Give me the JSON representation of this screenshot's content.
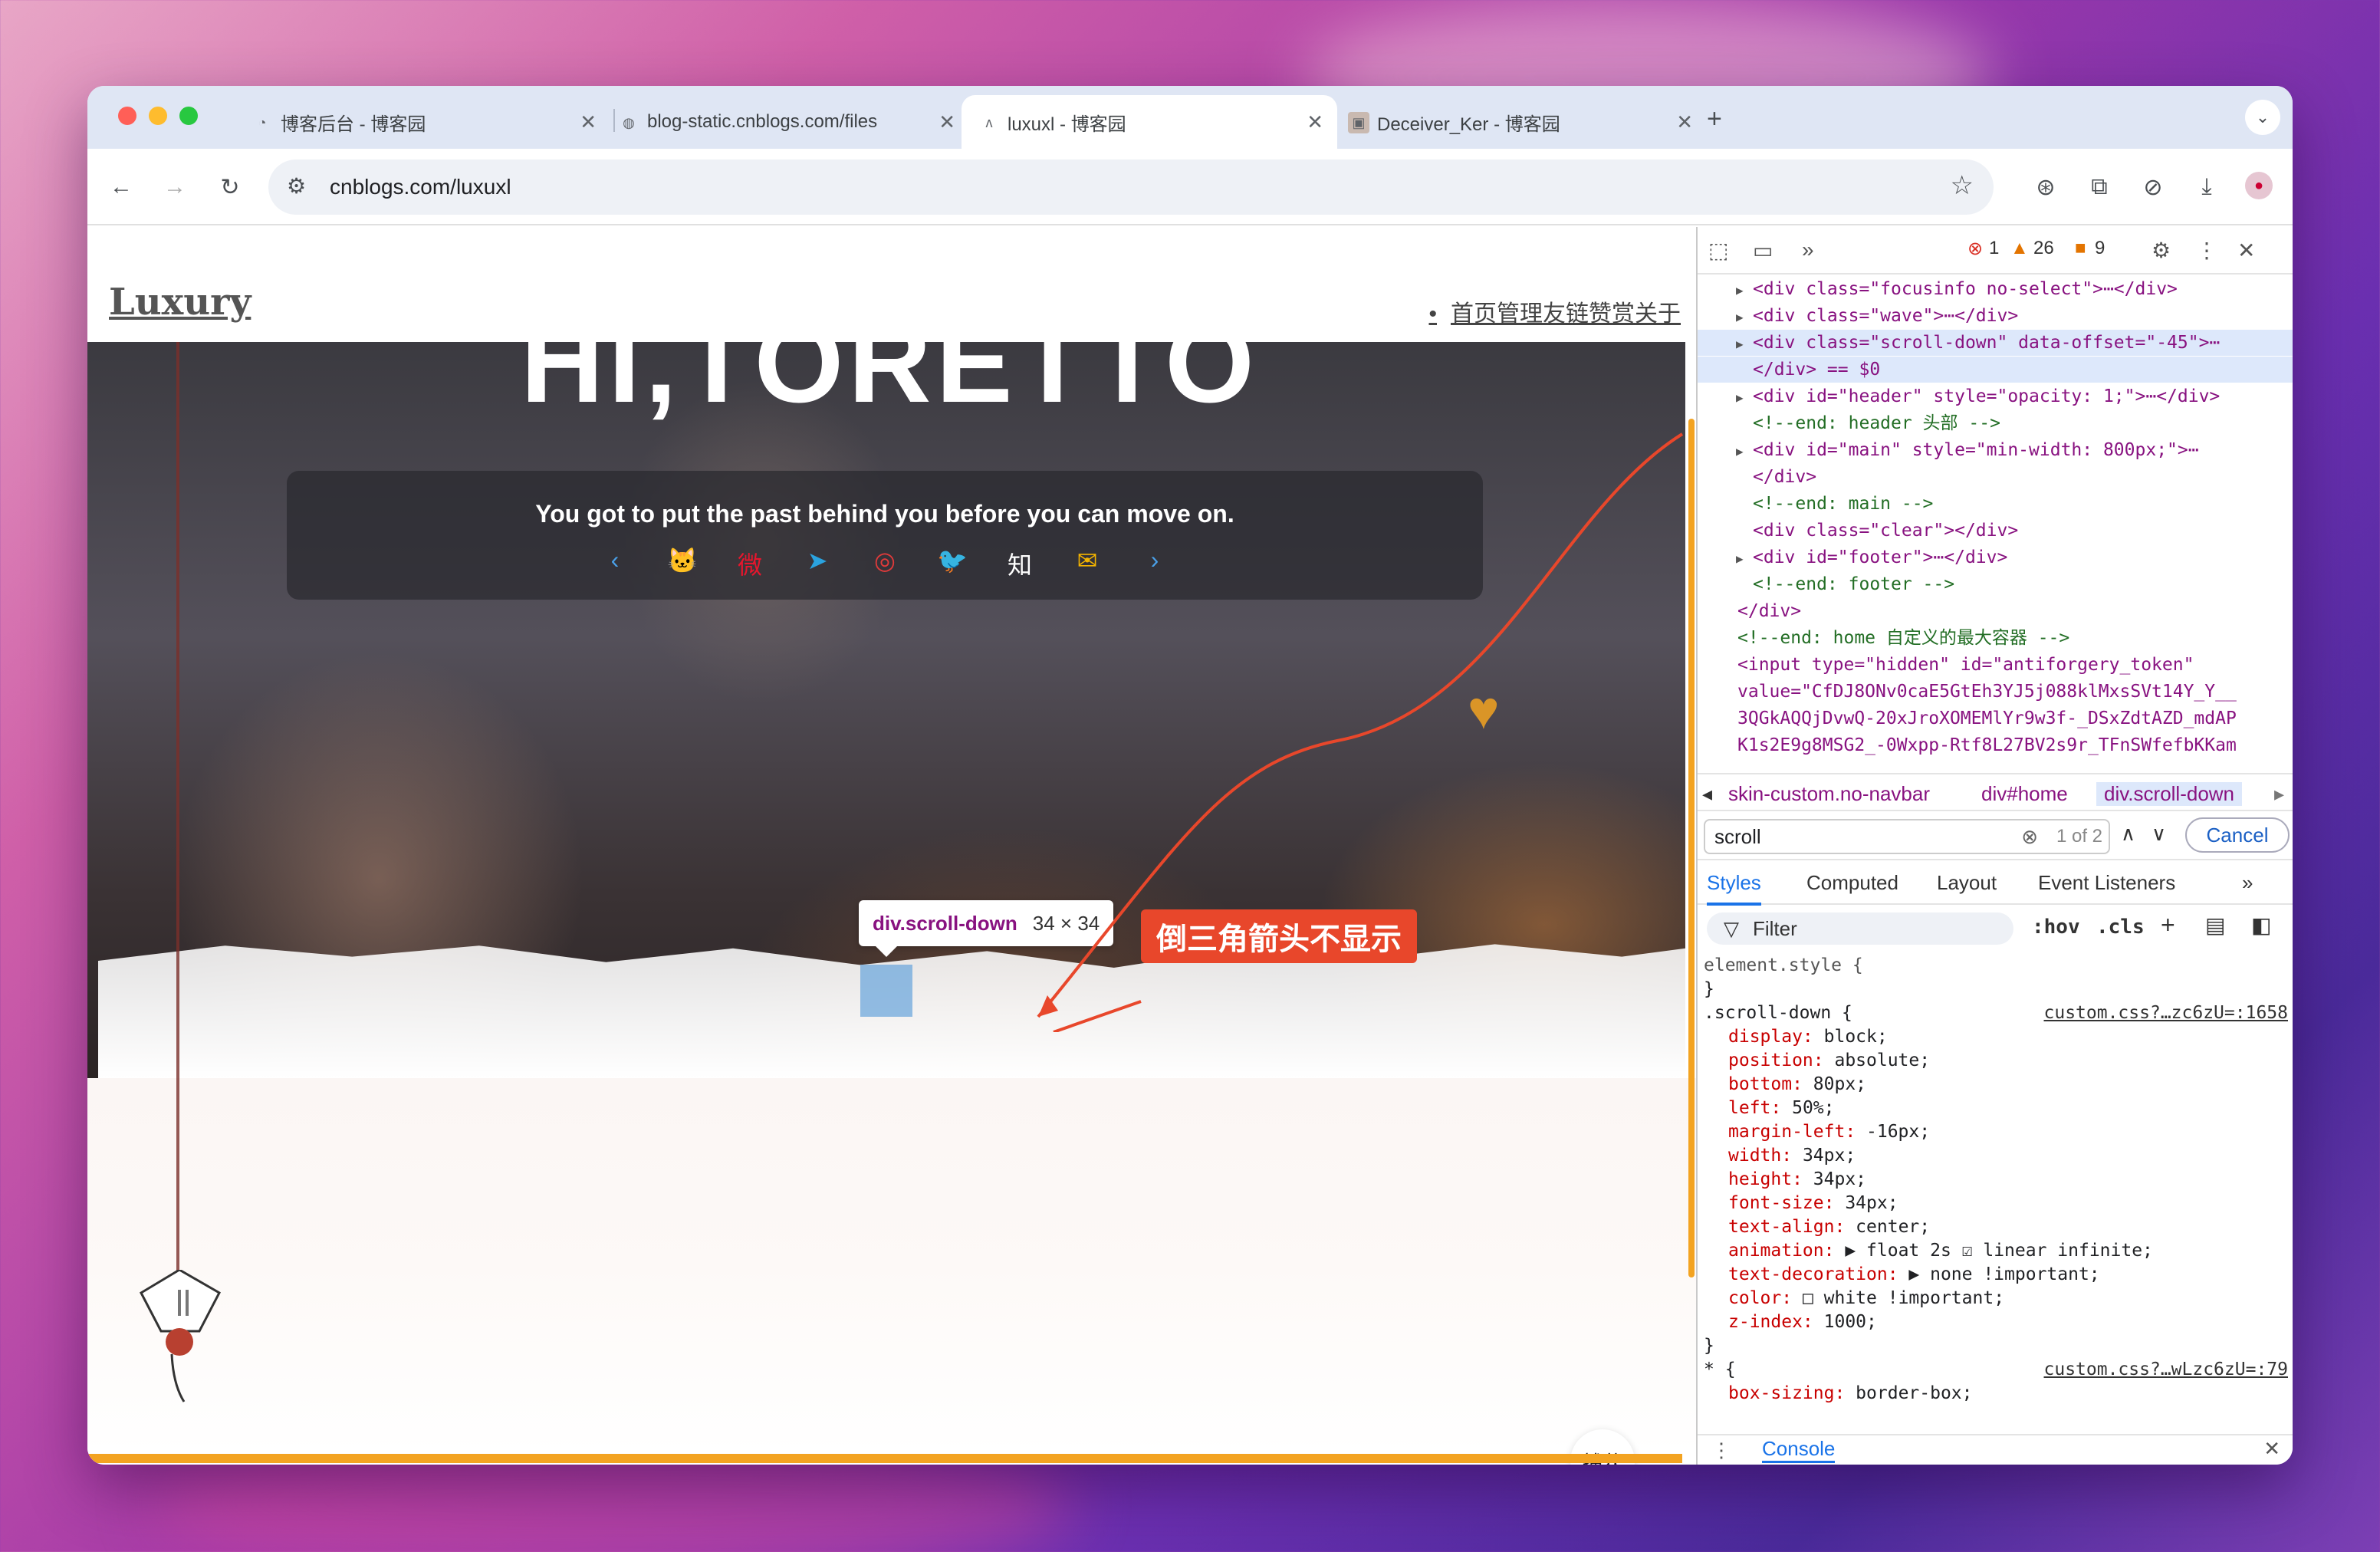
{
  "desktop": {
    "accent": "#a53aa8"
  },
  "browser": {
    "tabs": [
      {
        "title": "博客后台 - 博客园",
        "icon": "cnblogs-icon",
        "close": "✕"
      },
      {
        "title": "blog-static.cnblogs.com/files",
        "icon": "globe-icon",
        "close": "✕"
      },
      {
        "title": "luxuxl - 博客园",
        "icon": "cnblogs-icon",
        "close": "✕",
        "active": true
      },
      {
        "title": "Deceiver_Ker - 博客园",
        "icon": "avatar-icon",
        "close": "✕"
      }
    ],
    "new_tab": "+",
    "url": "cnblogs.com/luxuxl"
  },
  "page": {
    "logo": "Luxury",
    "nav": "首页管理友链赞赏关于",
    "hero_title": "HI,TORETTO",
    "quote": "You got to put the past behind you before you can move on.",
    "socials": [
      "‹",
      "🐱",
      "微",
      "➤",
      "◎",
      "🐦",
      "知",
      "✉",
      "›"
    ],
    "tooltip_tag": "div.scroll-down",
    "tooltip_dim": "34 × 34",
    "callout": "倒三角箭头不显示",
    "catch_button": "捕获",
    "progress_color": "#f3a321"
  },
  "devtools": {
    "errors": "1",
    "warnings": "26",
    "issues": "9",
    "dom": [
      {
        "indent": 2,
        "tri": "▶",
        "html": "&lt;div class=\"focusinfo no-select\"&gt;⋯&lt;/div&gt;"
      },
      {
        "indent": 2,
        "tri": "▶",
        "html": "&lt;div class=\"wave\"&gt;⋯&lt;/div&gt;"
      },
      {
        "indent": 2,
        "tri": "▶",
        "html": "&lt;div class=\"scroll-down\" data-offset=\"-45\"&gt;⋯",
        "selected": true
      },
      {
        "indent": 2,
        "tri": "",
        "html": "&lt;/div&gt; == $0",
        "selected": true
      },
      {
        "indent": 2,
        "tri": "▶",
        "html": "&lt;div id=\"header\" style=\"opacity: 1;\"&gt;⋯&lt;/div&gt;"
      },
      {
        "indent": 2,
        "tri": "",
        "html": "&lt;!--end: header 头部 --&gt;"
      },
      {
        "indent": 2,
        "tri": "▶",
        "html": "&lt;div id=\"main\" style=\"min-width: 800px;\"&gt;⋯"
      },
      {
        "indent": 2,
        "tri": "",
        "html": "&lt;/div&gt;"
      },
      {
        "indent": 2,
        "tri": "",
        "html": "&lt;!--end: main --&gt;"
      },
      {
        "indent": 2,
        "tri": "",
        "html": "&lt;div class=\"clear\"&gt;&lt;/div&gt;"
      },
      {
        "indent": 2,
        "tri": "▶",
        "html": "&lt;div id=\"footer\"&gt;⋯&lt;/div&gt;"
      },
      {
        "indent": 2,
        "tri": "",
        "html": "&lt;!--end: footer --&gt;"
      },
      {
        "indent": 1,
        "tri": "",
        "html": "&lt;/div&gt;"
      },
      {
        "indent": 1,
        "tri": "",
        "html": "&lt;!--end: home 自定义的最大容器 --&gt;"
      },
      {
        "indent": 1,
        "tri": "",
        "html": "&lt;input type=\"hidden\" id=\"antiforgery_token\""
      },
      {
        "indent": 1,
        "tri": "",
        "html": "value=\"CfDJ8ONv0caE5GtEh3YJ5j088klMxsSVt14Y_Y__"
      },
      {
        "indent": 1,
        "tri": "",
        "html": "3QGkAQQjDvwQ-20xJroXOMEMlYr9w3f-_DSxZdtAZD_mdAP"
      },
      {
        "indent": 1,
        "tri": "",
        "html": "K1s2E9g8MSG2_-0Wxpp-Rtf8L27BV2s9r_TFnSWfefbKKam"
      }
    ],
    "crumbs": [
      "skin-custom.no-navbar",
      "div#home",
      "div.scroll-down"
    ],
    "search_value": "scroll",
    "search_count": "1 of 2",
    "cancel": "Cancel",
    "tabs": [
      "Styles",
      "Computed",
      "Layout",
      "Event Listeners"
    ],
    "filter": "Filter",
    "hov": ":hov",
    "cls": ".cls",
    "styles": [
      {
        "t": "element.style {",
        "k": "sel"
      },
      {
        "t": "}",
        "k": "sel"
      },
      {
        "t": ".scroll-down {",
        "k": "sel",
        "src": "custom.css?…zc6zU=:1658"
      },
      {
        "t": "display: block;",
        "k": "prop"
      },
      {
        "t": "position: absolute;",
        "k": "prop"
      },
      {
        "t": "bottom: 80px;",
        "k": "prop"
      },
      {
        "t": "left: 50%;",
        "k": "prop"
      },
      {
        "t": "margin-left: -16px;",
        "k": "prop"
      },
      {
        "t": "width: 34px;",
        "k": "prop"
      },
      {
        "t": "height: 34px;",
        "k": "prop"
      },
      {
        "t": "font-size: 34px;",
        "k": "prop"
      },
      {
        "t": "text-align: center;",
        "k": "prop"
      },
      {
        "t": "animation: ▶ float 2s ☑ linear infinite;",
        "k": "prop"
      },
      {
        "t": "text-decoration: ▶ none !important;",
        "k": "prop"
      },
      {
        "t": "color: □ white !important;",
        "k": "prop"
      },
      {
        "t": "z-index: 1000;",
        "k": "prop"
      },
      {
        "t": "}",
        "k": "sel"
      },
      {
        "t": "* {",
        "k": "sel",
        "src": "custom.css?…wLzc6zU=:79"
      },
      {
        "t": "box-sizing: border-box;",
        "k": "prop"
      }
    ],
    "console": "Console"
  }
}
